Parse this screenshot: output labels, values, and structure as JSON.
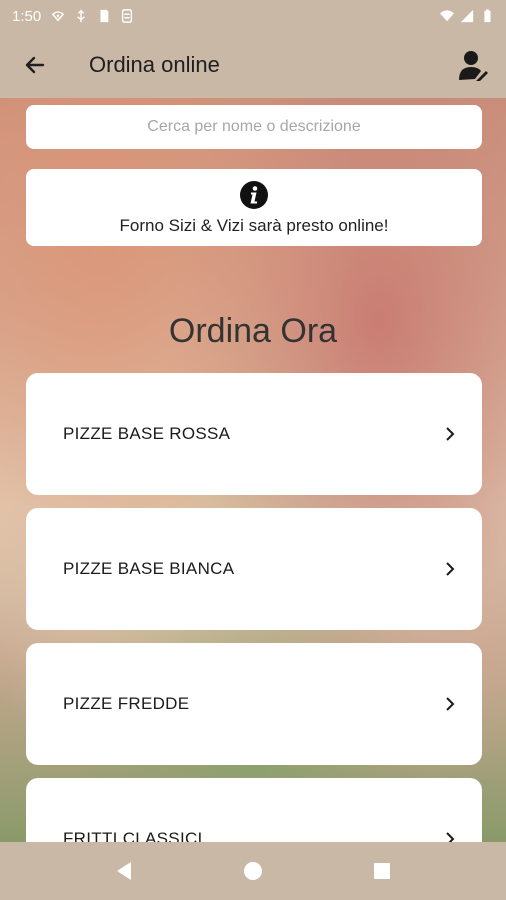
{
  "status_bar": {
    "time": "1:50",
    "icons": [
      "wifi-icon",
      "usb-icon",
      "sd-card-icon",
      "sync-icon"
    ],
    "right_icons": [
      "wifi-signal-icon",
      "cell-signal-icon",
      "battery-icon"
    ]
  },
  "app_bar": {
    "title": "Ordina online",
    "back_icon": "arrow-left-icon",
    "account_icon": "account-icon"
  },
  "search": {
    "placeholder": "Cerca per nome o descrizione"
  },
  "info": {
    "icon": "info-icon",
    "text": "Forno Sizi & Vizi sarà presto online!"
  },
  "section": {
    "title": "Ordina Ora"
  },
  "categories": [
    {
      "label": "PIZZE BASE ROSSA"
    },
    {
      "label": "PIZZE BASE BIANCA"
    },
    {
      "label": "PIZZE FREDDE"
    },
    {
      "label": "FRITTI CLASSICI"
    }
  ],
  "nav": {
    "back": "triangle-back-icon",
    "home": "circle-home-icon",
    "recents": "square-recents-icon"
  },
  "colors": {
    "bar": "#c9b8a6",
    "card": "#ffffff"
  }
}
